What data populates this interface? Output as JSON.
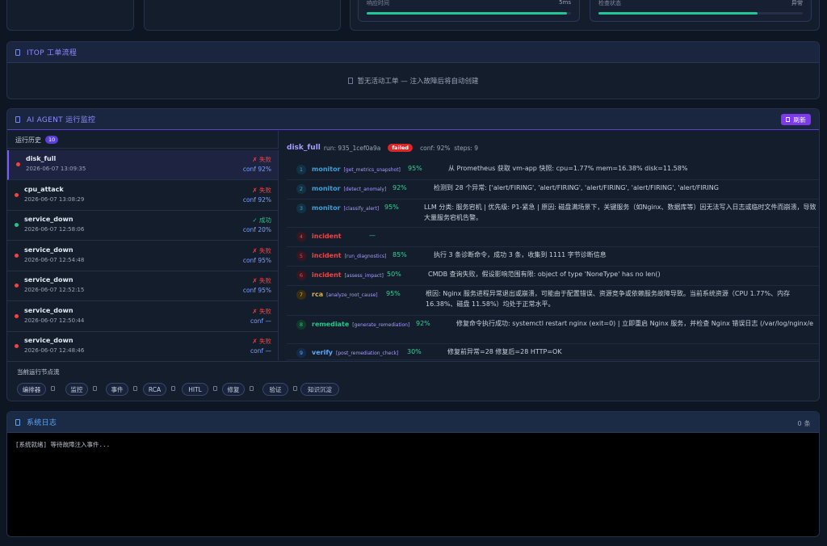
{
  "metrics": {
    "response_time": {
      "label": "响应时间",
      "value": "5ms",
      "fraction": 0.98
    },
    "probe_status": {
      "label": "检查状态",
      "value": "异常",
      "fraction": 0.78
    }
  },
  "itop": {
    "title": "ITOP 工单流程",
    "empty_text": "暂无活动工单 — 注入故障后将自动创建"
  },
  "agent": {
    "title": "AI AGENT 运行监控",
    "refresh_label": "刷新",
    "history_label": "运行历史",
    "history_count": "10",
    "runs": [
      {
        "name": "disk_full",
        "time": "2026-06-07 13:09:35",
        "status": "✗ 失败",
        "conf": "conf 92%",
        "ok": false,
        "selected": true
      },
      {
        "name": "cpu_attack",
        "time": "2026-06-07 13:08:29",
        "status": "✗ 失败",
        "conf": "conf 92%",
        "ok": false,
        "selected": false
      },
      {
        "name": "service_down",
        "time": "2026-06-07 12:58:06",
        "status": "✓ 成功",
        "conf": "conf 20%",
        "ok": true,
        "selected": false
      },
      {
        "name": "service_down",
        "time": "2026-06-07 12:54:48",
        "status": "✗ 失败",
        "conf": "conf 95%",
        "ok": false,
        "selected": false
      },
      {
        "name": "service_down",
        "time": "2026-06-07 12:52:15",
        "status": "✗ 失败",
        "conf": "conf 95%",
        "ok": false,
        "selected": false
      },
      {
        "name": "service_down",
        "time": "2026-06-07 12:50:44",
        "status": "✗ 失败",
        "conf": "conf —",
        "ok": false,
        "selected": false
      },
      {
        "name": "service_down",
        "time": "2026-06-07 12:48:46",
        "status": "✗ 失败",
        "conf": "conf —",
        "ok": false,
        "selected": false
      }
    ],
    "detail": {
      "name": "disk_full",
      "run": "run: 935_1cef0a9a",
      "badge": "failed",
      "meta": "conf: 92%  steps: 9",
      "steps": [
        {
          "num": "1",
          "stage": "monitor",
          "tool": "[get_metrics_snapshot]",
          "conf": "95%",
          "msg": "从 Prometheus 获取 vm-app 快照: cpu=1.77% mem=16.38% disk=11.58%"
        },
        {
          "num": "2",
          "stage": "monitor",
          "tool": "[detect_anomaly]",
          "conf": "92%",
          "msg": "检测到 28 个异常: ['alert/FIRING', 'alert/FIRING', 'alert/FIRING', 'alert/FIRING', 'alert/FIRING"
        },
        {
          "num": "3",
          "stage": "monitor",
          "tool": "[classify_alert]",
          "conf": "95%",
          "msg": "LLM 分类: 服务宕机 | 优先级: P1-紧急 | 原因: 磁盘满场景下，关键服务（如Nginx、数据库等）因无法写入日志或临时文件而崩溃，导致大量服务宕机告警。"
        },
        {
          "num": "4",
          "stage": "incident",
          "tool": "",
          "conf": "",
          "msg": "—"
        },
        {
          "num": "5",
          "stage": "incident",
          "tool": "[run_diagnostics]",
          "conf": "85%",
          "msg": "执行 3 条诊断命令，成功 3 条，收集到 1111 字节诊断信息"
        },
        {
          "num": "6",
          "stage": "incident",
          "tool": "[assess_impact]",
          "conf": "50%",
          "msg": "CMDB 查询失败，假设影响范围有限: object of type 'NoneType' has no len()"
        },
        {
          "num": "7",
          "stage": "rca",
          "tool": "[analyze_root_cause]",
          "conf": "95%",
          "msg": "根因: Nginx 服务进程异常退出或崩溃，可能由于配置错误、资源竞争或依赖服务故障导致。当前系统资源（CPU 1.77%、内存 16.38%、磁盘 11.58%）均处于正常水平。"
        },
        {
          "num": "8",
          "stage": "remediate",
          "tool": "[generate_remediation]",
          "conf": "92%",
          "msg": "修复命令执行成功: systemctl restart nginx (exit=0) | 立即重启 Nginx 服务，并检查 Nginx 错误日志 (/var/log/nginx/e"
        },
        {
          "num": "9",
          "stage": "verify",
          "tool": "[post_remediation_check]",
          "conf": "30%",
          "msg": "修复前异常=28 修复后=28 HTTP=OK"
        }
      ]
    },
    "flow_label": "当前运行节点流",
    "flow_nodes": [
      "编排器",
      "监控",
      "事件",
      "RCA",
      "HITL",
      "修复",
      "验证",
      "知识沉淀"
    ]
  },
  "syslog": {
    "title": "系统日志",
    "count": "0 条",
    "line": "[系统就绪] 等待故障注入事件..."
  }
}
